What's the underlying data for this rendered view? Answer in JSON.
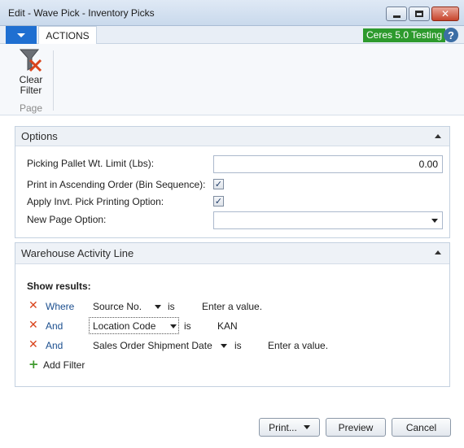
{
  "window": {
    "title": "Edit - Wave Pick - Inventory Picks",
    "close_glyph": "✕"
  },
  "ribbon": {
    "tab": "ACTIONS",
    "company": "Ceres 5.0 Testing",
    "help_glyph": "?",
    "clear_filter_line1": "Clear",
    "clear_filter_line2": "Filter",
    "group_label": "Page",
    "icon": "funnel-clear-icon"
  },
  "options": {
    "title": "Options",
    "fields": [
      {
        "label": "Picking Pallet Wt. Limit (Lbs):",
        "value": "0.00"
      },
      {
        "label": "Print in Ascending Order (Bin Sequence):",
        "checked": true
      },
      {
        "label": "Apply Invt. Pick Printing Option:",
        "checked": true
      },
      {
        "label": "New Page Option:",
        "value": ""
      }
    ],
    "check_glyph": "✓"
  },
  "warehouse": {
    "title": "Warehouse Activity Line",
    "show_results": "Show results:",
    "filters": [
      {
        "conj": "Where",
        "field": "Source No.",
        "op": "is",
        "value": "Enter a value."
      },
      {
        "conj": "And",
        "field": "Location Code",
        "op": "is",
        "value": "KAN"
      },
      {
        "conj": "And",
        "field": "Sales Order Shipment Date",
        "op": "is",
        "value": "Enter a value."
      }
    ],
    "remove_glyph": "✕",
    "add_glyph": "+",
    "add_filter": "Add Filter"
  },
  "buttons": {
    "print": "Print...",
    "preview": "Preview",
    "cancel": "Cancel"
  },
  "colors": {
    "accent": "#1f6fd1",
    "company_badge": "#2d9a2d",
    "remove_icon": "#d9441c",
    "add_icon": "#3f9a2e"
  }
}
